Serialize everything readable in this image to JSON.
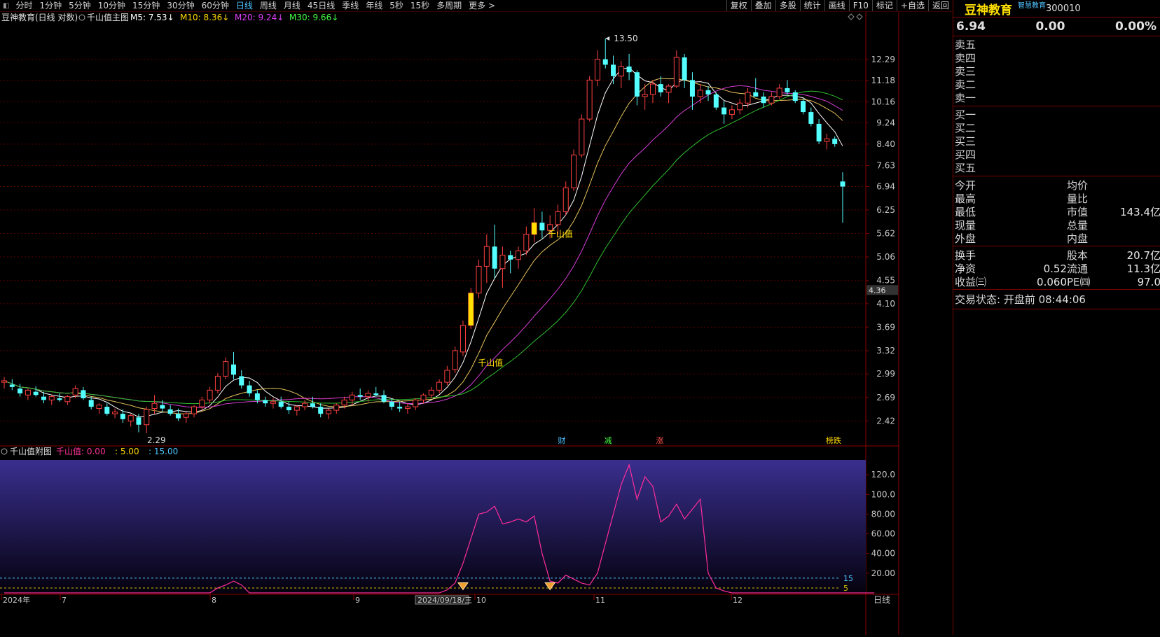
{
  "toolbar": {
    "periods": [
      "分时",
      "1分钟",
      "5分钟",
      "10分钟",
      "15分钟",
      "30分钟",
      "60分钟",
      "日线",
      "周线",
      "月线",
      "45日线",
      "季线",
      "年线",
      "5秒",
      "15秒",
      "多周期",
      "更多 >"
    ],
    "active_index": 7,
    "buttons": [
      "复权",
      "叠加",
      "多股",
      "统计",
      "画线",
      "F10",
      "标记",
      "+自选",
      "返回"
    ]
  },
  "main": {
    "title": "豆神教育(日线 对数)",
    "indicator": "千山值主图",
    "ma": [
      {
        "label": "M5: 7.53↓",
        "color": "#ffffff"
      },
      {
        "label": "M10: 8.36↓",
        "color": "#ffd700"
      },
      {
        "label": "M20: 9.24↓",
        "color": "#e040fb"
      },
      {
        "label": "M30: 9.66↓",
        "color": "#44ff44"
      }
    ],
    "y_ticks": [
      "12.29",
      "11.18",
      "10.16",
      "9.24",
      "8.40",
      "7.63",
      "6.94",
      "6.25",
      "5.62",
      "5.06",
      "4.55",
      "4.10",
      "3.69",
      "3.32",
      "2.99",
      "2.69",
      "2.42"
    ],
    "price_tag": "4.36",
    "high_label": "13.50",
    "low_label": "2.29",
    "signal_label": "千山值",
    "events": [
      {
        "label": "财",
        "color": "#4fc3ff"
      },
      {
        "label": "减",
        "color": "#44ff44"
      },
      {
        "label": "涨",
        "color": "#ff5050"
      },
      {
        "label": "榜跌",
        "color": "#ffd700"
      }
    ]
  },
  "sub": {
    "title": "千山值附图",
    "legend_name": "千山值",
    "legend_values": [
      ": 0.00",
      ": 5.00",
      ": 15.00"
    ],
    "legend_colors": [
      "#ff3399",
      "#ffd700",
      "#4fc3ff"
    ],
    "y_ticks": [
      "120.0",
      "100.0",
      "80.00",
      "60.00",
      "40.00",
      "20.00"
    ],
    "line15_label": "15",
    "line5_label": "5"
  },
  "xaxis": {
    "labels": [
      "2024年",
      "7",
      "8",
      "9",
      "2024/09/18/三",
      "10",
      "11",
      "12"
    ],
    "period_label": "日线"
  },
  "chart_data": {
    "type": "candlestick",
    "ylabel_scale": "log",
    "ylim": [
      2.29,
      13.5
    ],
    "candles": [
      [
        2.88,
        2.95,
        2.8,
        2.9
      ],
      [
        2.85,
        2.92,
        2.78,
        2.82
      ],
      [
        2.8,
        2.86,
        2.7,
        2.74
      ],
      [
        2.72,
        2.8,
        2.66,
        2.78
      ],
      [
        2.76,
        2.83,
        2.7,
        2.72
      ],
      [
        2.7,
        2.76,
        2.62,
        2.66
      ],
      [
        2.66,
        2.72,
        2.6,
        2.7
      ],
      [
        2.68,
        2.74,
        2.64,
        2.66
      ],
      [
        2.64,
        2.72,
        2.6,
        2.7
      ],
      [
        2.72,
        2.84,
        2.68,
        2.8
      ],
      [
        2.78,
        2.82,
        2.66,
        2.68
      ],
      [
        2.66,
        2.7,
        2.55,
        2.58
      ],
      [
        2.56,
        2.62,
        2.5,
        2.6
      ],
      [
        2.58,
        2.62,
        2.48,
        2.5
      ],
      [
        2.5,
        2.56,
        2.45,
        2.52
      ],
      [
        2.5,
        2.55,
        2.4,
        2.44
      ],
      [
        2.42,
        2.5,
        2.36,
        2.48
      ],
      [
        2.46,
        2.5,
        2.3,
        2.38
      ],
      [
        2.38,
        2.58,
        2.29,
        2.55
      ],
      [
        2.56,
        2.72,
        2.5,
        2.62
      ],
      [
        2.6,
        2.66,
        2.52,
        2.56
      ],
      [
        2.55,
        2.6,
        2.48,
        2.5
      ],
      [
        2.5,
        2.56,
        2.42,
        2.45
      ],
      [
        2.46,
        2.52,
        2.4,
        2.5
      ],
      [
        2.5,
        2.6,
        2.46,
        2.58
      ],
      [
        2.58,
        2.7,
        2.54,
        2.66
      ],
      [
        2.66,
        2.82,
        2.62,
        2.78
      ],
      [
        2.78,
        3.0,
        2.74,
        2.96
      ],
      [
        2.96,
        3.22,
        2.92,
        3.16
      ],
      [
        3.12,
        3.3,
        2.92,
        2.98
      ],
      [
        2.96,
        3.04,
        2.8,
        2.84
      ],
      [
        2.84,
        2.9,
        2.7,
        2.74
      ],
      [
        2.74,
        2.78,
        2.62,
        2.66
      ],
      [
        2.66,
        2.7,
        2.58,
        2.62
      ],
      [
        2.62,
        2.68,
        2.56,
        2.64
      ],
      [
        2.64,
        2.7,
        2.56,
        2.58
      ],
      [
        2.58,
        2.64,
        2.5,
        2.54
      ],
      [
        2.54,
        2.6,
        2.48,
        2.58
      ],
      [
        2.58,
        2.66,
        2.54,
        2.62
      ],
      [
        2.62,
        2.7,
        2.56,
        2.58
      ],
      [
        2.58,
        2.62,
        2.46,
        2.5
      ],
      [
        2.5,
        2.56,
        2.44,
        2.54
      ],
      [
        2.54,
        2.62,
        2.5,
        2.6
      ],
      [
        2.6,
        2.7,
        2.56,
        2.66
      ],
      [
        2.66,
        2.76,
        2.6,
        2.72
      ],
      [
        2.72,
        2.8,
        2.66,
        2.7
      ],
      [
        2.7,
        2.78,
        2.64,
        2.74
      ],
      [
        2.74,
        2.82,
        2.7,
        2.72
      ],
      [
        2.72,
        2.78,
        2.62,
        2.64
      ],
      [
        2.64,
        2.68,
        2.54,
        2.58
      ],
      [
        2.58,
        2.64,
        2.52,
        2.56
      ],
      [
        2.56,
        2.62,
        2.5,
        2.58
      ],
      [
        2.58,
        2.68,
        2.54,
        2.66
      ],
      [
        2.66,
        2.74,
        2.62,
        2.72
      ],
      [
        2.72,
        2.82,
        2.68,
        2.78
      ],
      [
        2.78,
        2.92,
        2.74,
        2.88
      ],
      [
        2.88,
        3.1,
        2.84,
        3.04
      ],
      [
        3.05,
        3.38,
        3.0,
        3.32
      ],
      [
        3.3,
        3.8,
        3.24,
        3.72
      ],
      [
        3.72,
        4.4,
        3.66,
        4.3
      ],
      [
        4.3,
        5.0,
        4.2,
        4.85
      ],
      [
        4.85,
        5.6,
        4.5,
        5.3
      ],
      [
        5.3,
        5.85,
        4.6,
        4.8
      ],
      [
        4.8,
        5.3,
        4.4,
        5.1
      ],
      [
        5.1,
        5.2,
        4.7,
        5.0
      ],
      [
        5.0,
        5.3,
        4.8,
        5.2
      ],
      [
        5.2,
        5.8,
        5.1,
        5.6
      ],
      [
        5.6,
        6.3,
        5.4,
        5.9
      ],
      [
        5.9,
        6.2,
        5.5,
        5.7
      ],
      [
        5.7,
        6.1,
        5.5,
        5.85
      ],
      [
        5.85,
        6.4,
        5.6,
        6.2
      ],
      [
        6.2,
        7.1,
        6.1,
        6.9
      ],
      [
        6.9,
        8.2,
        6.8,
        8.0
      ],
      [
        8.0,
        9.6,
        7.9,
        9.4
      ],
      [
        9.4,
        11.4,
        9.3,
        11.2
      ],
      [
        11.2,
        12.8,
        10.9,
        12.3
      ],
      [
        12.3,
        13.5,
        11.8,
        12.0
      ],
      [
        12.0,
        12.5,
        11.0,
        11.4
      ],
      [
        11.4,
        12.2,
        10.8,
        11.9
      ],
      [
        11.9,
        12.6,
        11.2,
        11.6
      ],
      [
        11.6,
        11.7,
        10.0,
        10.4
      ],
      [
        10.4,
        11.0,
        9.8,
        10.5
      ],
      [
        10.5,
        11.2,
        10.1,
        11.0
      ],
      [
        11.0,
        11.4,
        10.4,
        10.6
      ],
      [
        10.6,
        11.0,
        10.1,
        10.9
      ],
      [
        10.9,
        12.8,
        10.8,
        12.4
      ],
      [
        12.4,
        12.6,
        10.8,
        11.2
      ],
      [
        11.2,
        11.6,
        9.8,
        10.4
      ],
      [
        10.4,
        11.0,
        10.1,
        10.7
      ],
      [
        10.7,
        10.9,
        10.2,
        10.5
      ],
      [
        10.5,
        10.6,
        9.8,
        9.9
      ],
      [
        9.9,
        10.2,
        9.2,
        9.6
      ],
      [
        9.6,
        10.0,
        9.4,
        9.8
      ],
      [
        9.8,
        10.3,
        9.6,
        10.1
      ],
      [
        10.1,
        10.8,
        9.9,
        10.6
      ],
      [
        10.6,
        11.3,
        10.4,
        10.4
      ],
      [
        10.4,
        10.6,
        9.9,
        10.1
      ],
      [
        10.1,
        10.6,
        10.0,
        10.4
      ],
      [
        10.4,
        11.0,
        10.3,
        10.8
      ],
      [
        10.8,
        11.2,
        10.5,
        10.6
      ],
      [
        10.6,
        10.7,
        10.1,
        10.2
      ],
      [
        10.2,
        10.3,
        9.6,
        9.7
      ],
      [
        9.7,
        9.9,
        9.1,
        9.2
      ],
      [
        9.2,
        9.4,
        8.4,
        8.5
      ],
      [
        8.5,
        8.8,
        8.2,
        8.6
      ],
      [
        8.6,
        8.7,
        8.3,
        8.4
      ],
      [
        7.1,
        7.4,
        5.9,
        6.94
      ]
    ],
    "qianshan": [
      0.0,
      0.0,
      0.0,
      0.0,
      0.0,
      0.0,
      0.0,
      0.0,
      0.0,
      0.0,
      0.0,
      0.0,
      0.0,
      0.0,
      0.0,
      0.0,
      0.0,
      0.0,
      0.0,
      0.0,
      0.0,
      0.0,
      0.0,
      0.0,
      0.0,
      0.0,
      0.0,
      5.0,
      8.0,
      12.0,
      8.0,
      0.0,
      0.0,
      0.0,
      0.0,
      0.0,
      0.0,
      0.0,
      0.0,
      0.0,
      0.0,
      0.0,
      0.0,
      0.0,
      0.0,
      0.0,
      0.0,
      0.0,
      0.0,
      0.0,
      0.0,
      0.0,
      0.0,
      0.0,
      0.0,
      0.0,
      3.0,
      10.0,
      30.0,
      55.0,
      80.0,
      82.0,
      88.0,
      70.0,
      72.0,
      75.0,
      72.0,
      78.0,
      40.0,
      12.0,
      10.0,
      18.0,
      14.0,
      10.0,
      8.0,
      20.0,
      50.0,
      80.0,
      110.0,
      130.0,
      95.0,
      118.0,
      108.0,
      72.0,
      78.0,
      90.0,
      75.0,
      85.0,
      95.0,
      20.0,
      5.0,
      2.0,
      0.0,
      0.0,
      0.0,
      0.0,
      0.0,
      0.0,
      0.0,
      0.0,
      0.0,
      0.0,
      0.0,
      0.0,
      0.0,
      0.0,
      0.0,
      0.0,
      0.0,
      0.0,
      0.0
    ],
    "ma_lines": [
      "M5",
      "M10",
      "M20",
      "M30"
    ]
  },
  "panel": {
    "name": "豆神教育",
    "sub_name": "智慧教育",
    "code": "300010",
    "price": "6.94",
    "change": "0.00",
    "change_pct": "0.00%",
    "sell_labels": [
      "卖五",
      "卖四",
      "卖三",
      "卖二",
      "卖一"
    ],
    "buy_labels": [
      "买一",
      "买二",
      "买三",
      "买四",
      "买五"
    ],
    "stats1": [
      [
        "今开",
        "",
        "均价",
        ""
      ],
      [
        "最高",
        "",
        "量比",
        ""
      ],
      [
        "最低",
        "",
        "市值",
        "143.4亿"
      ],
      [
        "现量",
        "",
        "总量",
        ""
      ],
      [
        "外盘",
        "",
        "内盘",
        ""
      ]
    ],
    "stats2": [
      [
        "换手",
        "",
        "股本",
        "20.7亿"
      ],
      [
        "净资",
        "0.52",
        "流通",
        "11.3亿"
      ],
      [
        "收益㈢",
        "0.060",
        "PE㈣",
        "97.0"
      ]
    ],
    "status_text": "交易状态: 开盘前 08:44:06"
  }
}
